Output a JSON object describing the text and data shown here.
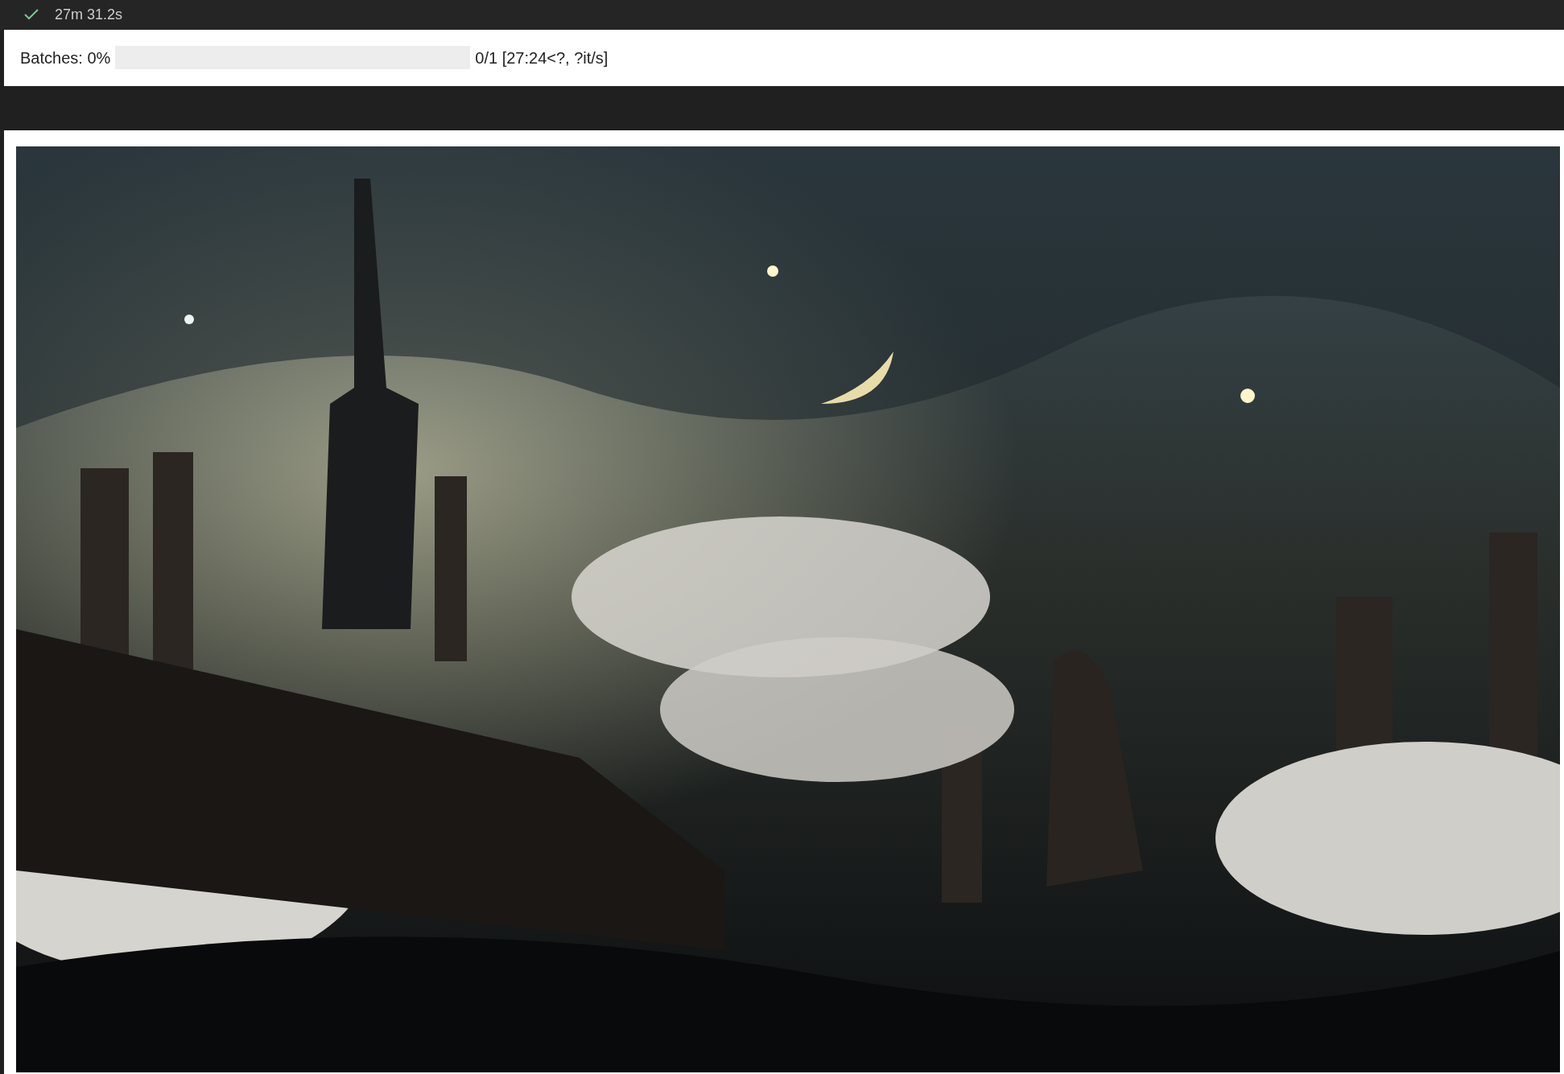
{
  "cell_status": {
    "succeeded": true,
    "duration": "27m 31.2s"
  },
  "progress": {
    "label": "Batches: 0%",
    "level": 0,
    "reading": "0/1 [27:24<?, ?it/s]"
  }
}
